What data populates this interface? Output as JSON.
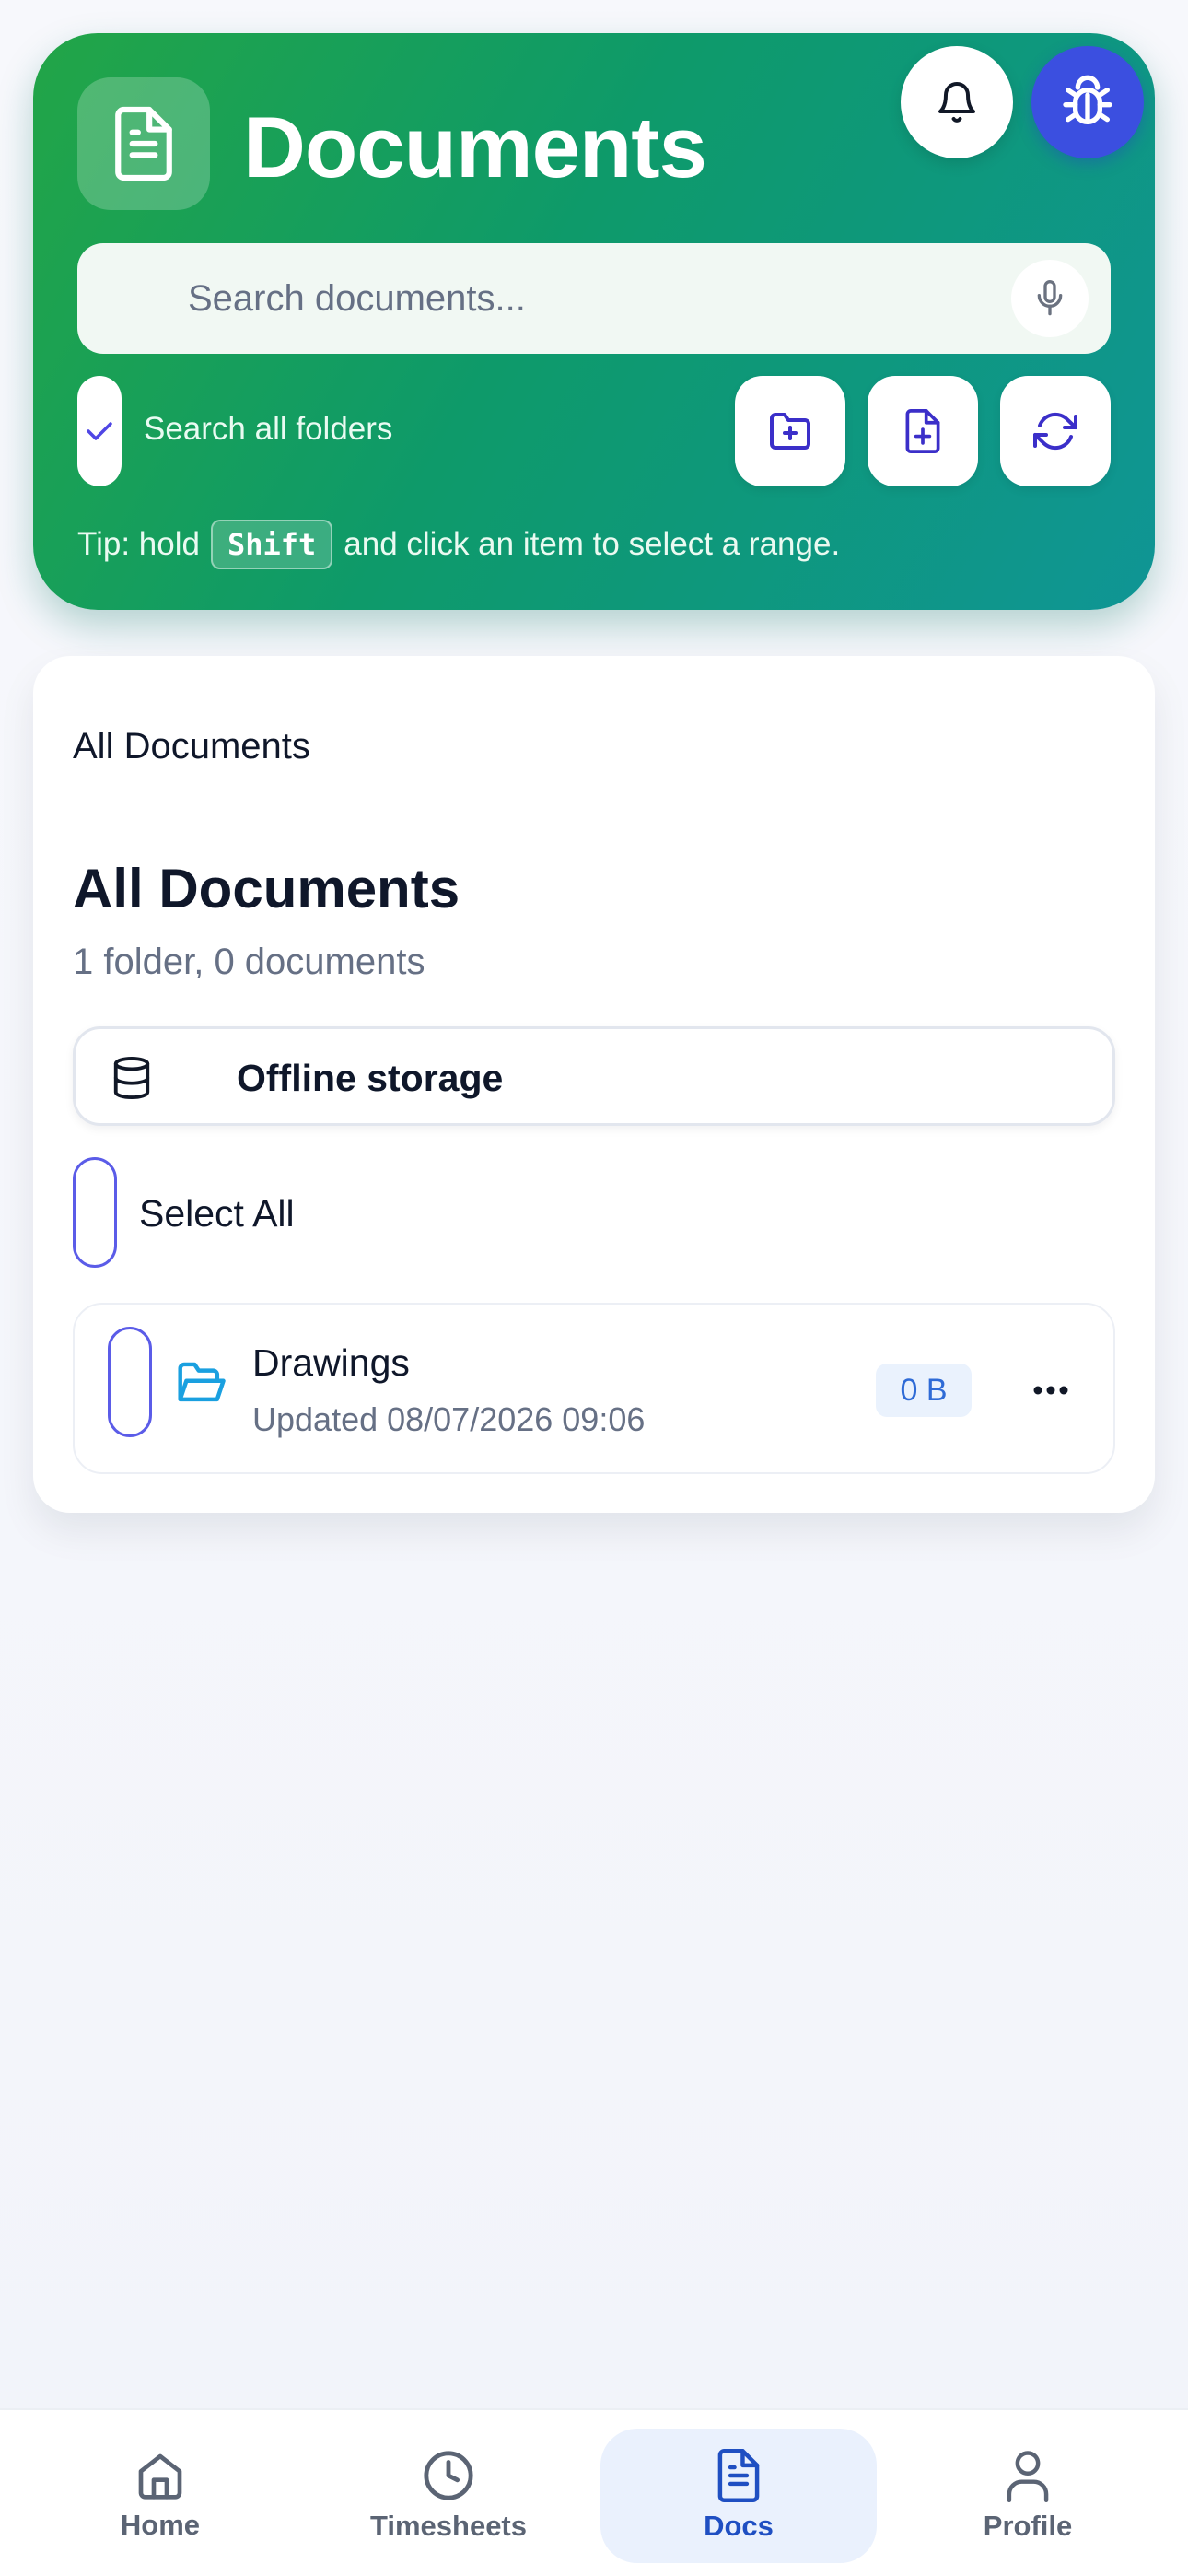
{
  "header": {
    "title": "Documents",
    "search_placeholder": "Search documents...",
    "search_all_folders_label": "Search all folders",
    "tip_before": "Tip: hold",
    "tip_key": "Shift",
    "tip_after": "and click an item to select a range."
  },
  "main": {
    "breadcrumb": "All Documents",
    "title": "All Documents",
    "subtitle": "1 folder, 0 documents",
    "offline_storage_label": "Offline storage",
    "select_all_label": "Select All",
    "items": [
      {
        "name": "Drawings",
        "updated": "Updated 08/07/2026 09:06",
        "size": "0 B",
        "type": "folder",
        "icon": "folder-open-icon"
      }
    ]
  },
  "bottom_nav": {
    "items": [
      {
        "label": "Home",
        "icon": "home-icon",
        "active": false
      },
      {
        "label": "Timesheets",
        "icon": "clock-icon",
        "active": false
      },
      {
        "label": "Docs",
        "icon": "document-icon",
        "active": true
      },
      {
        "label": "Profile",
        "icon": "user-icon",
        "active": false
      }
    ]
  },
  "colors": {
    "header_gradient_start": "#22a547",
    "header_gradient_end": "#0f9595",
    "accent_indigo": "#5b5ce8",
    "bug_button": "#3b4fe0",
    "nav_active": "#1f4fc2",
    "folder_icon": "#1aa0e0"
  },
  "icons": {
    "app": "document-icon",
    "notifications": "bell-icon",
    "debug": "bug-icon",
    "voice": "microphone-icon",
    "new_folder": "folder-plus-icon",
    "new_document": "file-plus-icon",
    "refresh": "refresh-icon",
    "offline": "database-icon",
    "more": "ellipsis-icon"
  }
}
